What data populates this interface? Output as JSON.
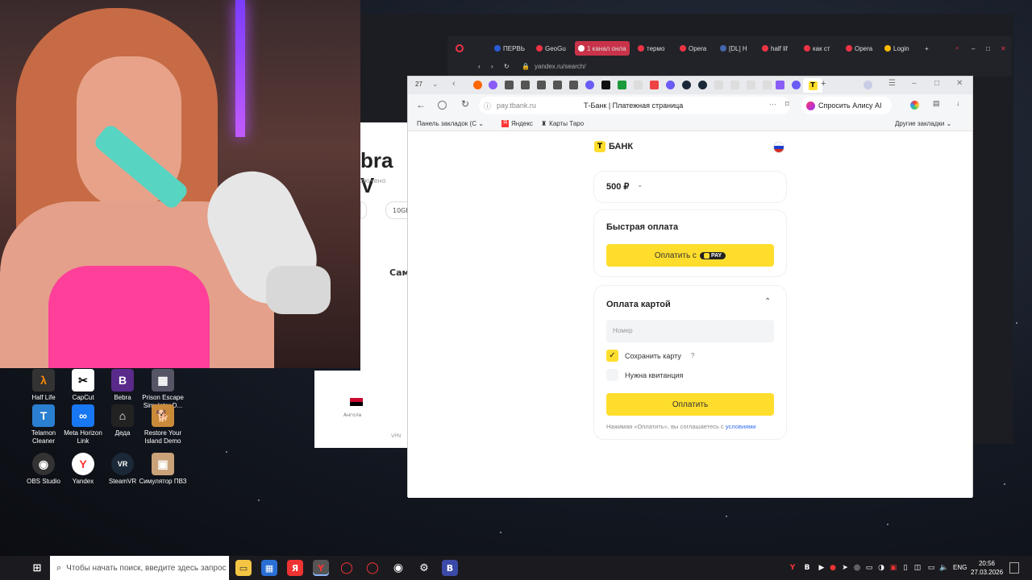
{
  "desktop_icons": [
    {
      "label": "Half Life",
      "icon": "half-life-icon"
    },
    {
      "label": "CapCut",
      "icon": "capcut-icon"
    },
    {
      "label": "Bebra",
      "icon": "bebra-icon"
    },
    {
      "label": "Prison Escape Simulator D...",
      "icon": "prison-escape-icon"
    },
    {
      "label": "Telamon Cleaner",
      "icon": "telamon-icon"
    },
    {
      "label": "Meta Horizon Link",
      "icon": "meta-icon"
    },
    {
      "label": "Деда",
      "icon": "deda-icon"
    },
    {
      "label": "Restore Your Island Demo",
      "icon": "island-icon"
    },
    {
      "label": "OBS Studio",
      "icon": "obs-icon"
    },
    {
      "label": "Yandex",
      "icon": "yandex-icon"
    },
    {
      "label": "SteamVR",
      "icon": "steamvr-icon"
    },
    {
      "label": "Симулятор ПВЗ",
      "icon": "pvz-icon"
    }
  ],
  "opera": {
    "tabs": [
      "ПЕРВЬ",
      "GeoGu",
      "1 канал онла",
      "термо",
      "Opera",
      "[DL] H",
      "half lif",
      "как ст",
      "Opera",
      "Login"
    ],
    "url": "yandex.ru/search/",
    "bg_text": {
      "big": "bra V",
      "sub": "лючено",
      "pill": "10GB",
      "sam": "Сам",
      "angola": "Ангола",
      "vpn": "VPN"
    }
  },
  "yandex_browser": {
    "tab_count": "27",
    "url": "pay.tbank.ru",
    "page_title": "Т-Банк | Платежная страница",
    "alice_button": "Спросить Алису AI",
    "bookmarks": [
      "Панель закладок (С",
      "Яндекс",
      "Карты Таро"
    ],
    "other_bookmarks": "Другие закладки"
  },
  "payment": {
    "brand": "БАНК",
    "amount": "500 ₽",
    "fast_pay_title": "Быстрая оплата",
    "pay_with": "Оплатить с",
    "pay_badge": "PAY",
    "card_section_title": "Оплата картой",
    "card_number_placeholder": "Номер",
    "save_card_label": "Сохранить карту",
    "save_card_help": "?",
    "save_card_checked": true,
    "receipt_label": "Нужна квитанция",
    "receipt_checked": false,
    "pay_button": "Оплатить",
    "terms_text": "Нажимая «Оплатить», вы соглашаетесь с",
    "terms_link": "условиями"
  },
  "taskbar": {
    "search_placeholder": "Чтобы начать поиск, введите здесь запрос",
    "lang": "ENG",
    "time": "20:56",
    "date": "27.03.2026"
  },
  "colors": {
    "tbank_yellow": "#ffdd2d",
    "link": "#336fee"
  }
}
